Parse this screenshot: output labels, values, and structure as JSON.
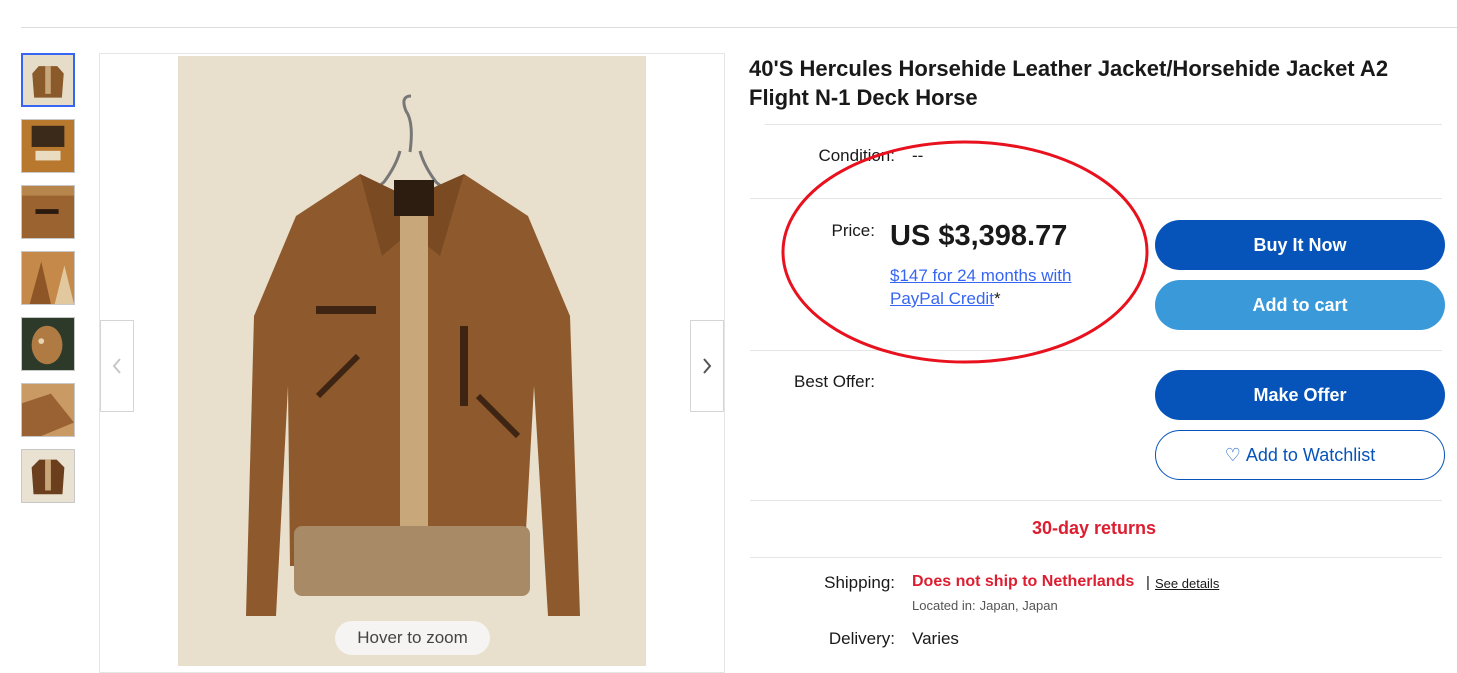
{
  "product": {
    "title": "40'S Hercules Horsehide Leather Jacket/Horsehide Jacket A2 Flight N-1 Deck Horse"
  },
  "gallery": {
    "thumbnails": [
      "thumb-1",
      "thumb-2",
      "thumb-3",
      "thumb-4",
      "thumb-5",
      "thumb-6",
      "thumb-7"
    ],
    "hover_label": "Hover to zoom",
    "prev_icon": "chevron-left-icon",
    "next_icon": "chevron-right-icon"
  },
  "details": {
    "condition_label": "Condition:",
    "condition_value": "--",
    "price_label": "Price:",
    "price_value": "US $3,398.77",
    "credit_link": "$147 for 24 months with PayPal Credit",
    "credit_asterisk": "*",
    "best_offer_label": "Best Offer:",
    "returns": "30-day returns",
    "shipping_label": "Shipping:",
    "shipping_warning": "Does not ship to Netherlands",
    "shipping_separator": "|",
    "see_details": "See details",
    "located_label": "Located in:",
    "located_value": "Japan, Japan",
    "delivery_label": "Delivery:",
    "delivery_value": "Varies"
  },
  "actions": {
    "buy_now": "Buy It Now",
    "add_to_cart": "Add to cart",
    "make_offer": "Make Offer",
    "watchlist": "Add to Watchlist",
    "watchlist_icon": "heart-icon"
  },
  "colors": {
    "primary_blue": "#0654ba",
    "cart_blue": "#3a9ad9",
    "link_blue": "#3665f3",
    "alert_red": "#dd1e31",
    "annotation_red": "#e8121e"
  }
}
